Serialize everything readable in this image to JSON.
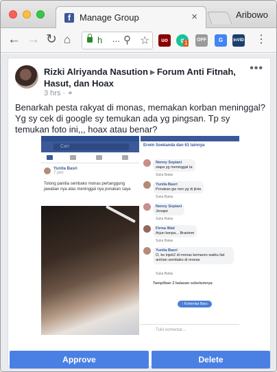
{
  "browser": {
    "tab_title": "Manage Group",
    "tab_close": "×",
    "profile_name": "Aribowo",
    "url_display": "h",
    "url_ellipsis": "...",
    "extensions": [
      {
        "name": "ublock-icon",
        "label": "uo",
        "color": "#8a0000"
      },
      {
        "name": "grammarly-icon",
        "label": "g",
        "color": "#15c39a",
        "badge": "1"
      },
      {
        "name": "off-icon",
        "label": "OFF",
        "color": "#999999"
      },
      {
        "name": "translate-icon",
        "label": "G",
        "color": "#4285f4"
      },
      {
        "name": "invid-icon",
        "label": "InVID",
        "color": "#1c3f6e"
      }
    ]
  },
  "post": {
    "author": "Rizki Alriyanda Nasution",
    "arrow": "▶",
    "group": "Forum Anti Fitnah, Hasut, dan Hoax",
    "time": "3 hrs",
    "separator": "·",
    "more": "•••",
    "text": "Benarkah pesta rakyat di monas, memakan korban meninggal? Yg sy cek di google sy temukan ada yg pingsan. Tp sy temukan foto ini,,, hoax atau benar?"
  },
  "screenshot_left": {
    "search": "Cari",
    "poster": "Yunita Basri",
    "poster_time": "7 jam",
    "text": "Tolong panitia sembako monas pertanggung jawaban nya atas meninggal nya ponakan saya"
  },
  "screenshot_right": {
    "header": "Erwin Soekanda dan 61 lainnya",
    "comments": [
      {
        "name": "Nenny Sopiani",
        "text": "siapa yg meninggal ta",
        "color": "#c98d8a"
      },
      {
        "name": "Yunita Basri",
        "text": "Ponakan gw nen yg di jkrta",
        "color": "#b58a78"
      },
      {
        "name": "Nenny Sopiani",
        "text": "Jenape",
        "color": "#c98d8a"
      },
      {
        "name": "Firma Wati",
        "text": "Arjun kenpa... Brantem",
        "color": "#8f6a5a"
      },
      {
        "name": "Yunita Basri",
        "text": "O, ke injek2 di monas kemaren waktu liat antrian sembako di monas",
        "color": "#b58a78"
      }
    ],
    "actions": "Suka   Balas",
    "replies": "Tampilkan 2 balasan sebelumnya",
    "pill": "↑ Komentar Baru",
    "compose": "Tulis komentar..."
  },
  "actions": {
    "approve": "Approve",
    "delete": "Delete"
  }
}
